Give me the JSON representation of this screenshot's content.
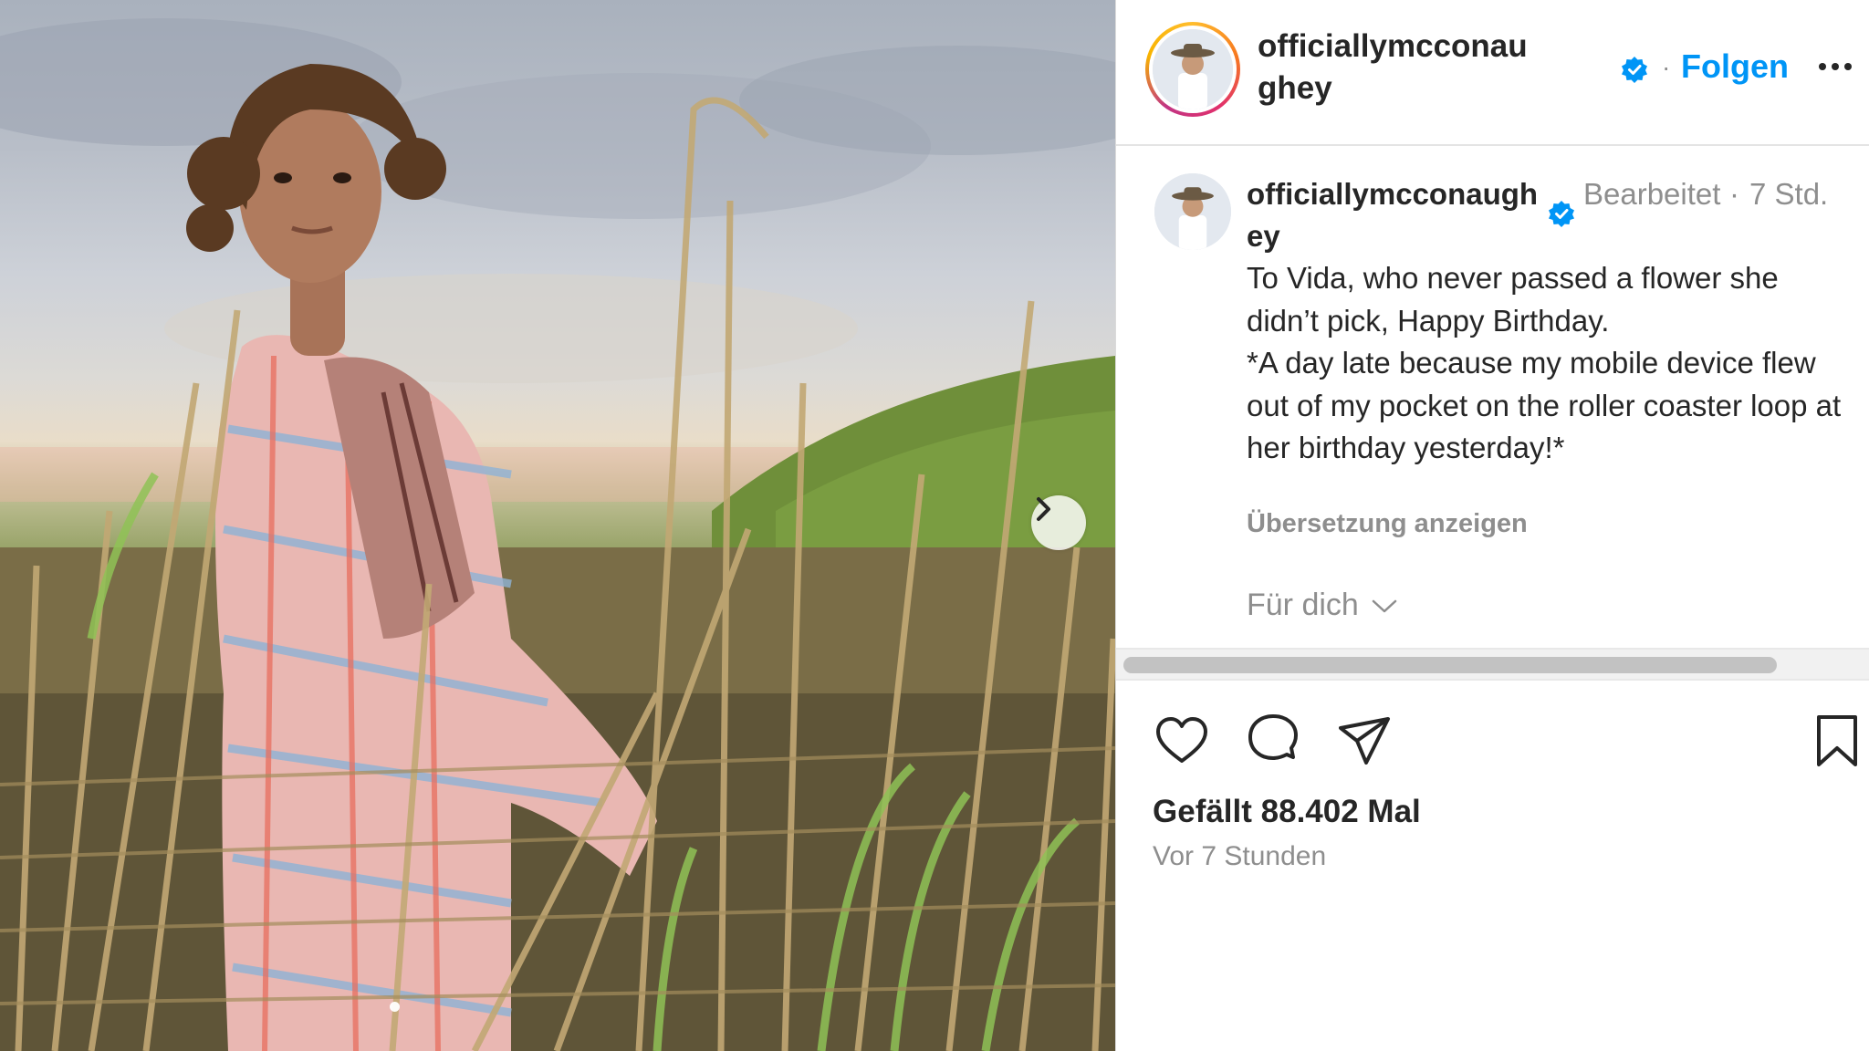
{
  "post": {
    "username_header": "officiallymcconaughey",
    "follow_label": "Folgen",
    "separator": "·",
    "caption": {
      "username": "officiallymcconaughey",
      "edited_label": "Bearbeitet",
      "separator": "·",
      "time": "7 Std.",
      "text": "To Vida, who never passed a flower she didn’t pick, Happy Birthday.\n*A day late because my mobile device flew out of my pocket on the roller coaster loop at her birthday yesterday!*",
      "translate_label": "Übersetzung anzeigen",
      "for_you_label": "Für dich"
    },
    "likes_text": "Gefällt 88.402 Mal",
    "posted_ago": "Vor 7 Stunden",
    "carousel": {
      "slide_count": 2,
      "active_slide": 1
    }
  },
  "icons": [
    "verified-badge-icon",
    "more-options-icon",
    "chevron-right-icon",
    "chevron-down-icon",
    "heart-icon",
    "comment-icon",
    "share-icon",
    "bookmark-icon"
  ],
  "colors": {
    "accent": "#0095f6",
    "text": "#262626",
    "secondary": "#8e8e8e",
    "verified": "#0095f6"
  }
}
